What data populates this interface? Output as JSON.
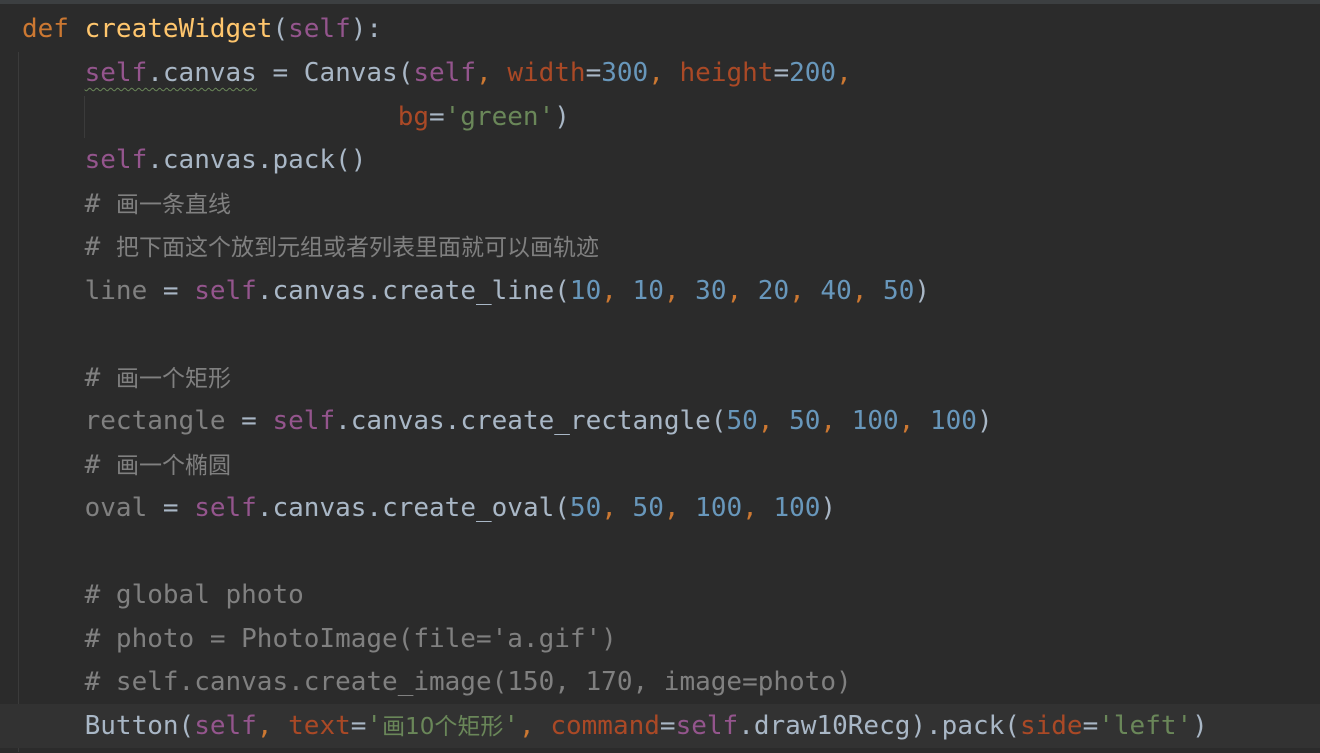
{
  "colors": {
    "background": "#2b2b2b",
    "keyword": "#cc7832",
    "function_name": "#ffc66d",
    "self": "#94558d",
    "parameter": "#aa4926",
    "number": "#6897bb",
    "string": "#6a8759",
    "comment": "#808080",
    "identifier": "#a9b7c6"
  },
  "code": {
    "l1": {
      "def": "def",
      "sp": " ",
      "func": "createWidget",
      "open": "(",
      "self": "self",
      "close": "):"
    },
    "l2": {
      "indent": "    ",
      "self": "self",
      "attr": ".canvas",
      "assign": " = Canvas(",
      "self2": "self",
      "c1": ", ",
      "p_width": "width",
      "eq1": "=",
      "n300": "300",
      "c2": ", ",
      "p_height": "height",
      "eq2": "=",
      "n200": "200",
      "c3": ","
    },
    "l3": {
      "indent": "                        ",
      "p_bg": "bg",
      "eq": "=",
      "str": "'green'",
      "close": ")"
    },
    "l4": {
      "indent": "    ",
      "self": "self",
      "rest": ".canvas.pack()"
    },
    "l5": {
      "indent": "    ",
      "hash": "# ",
      "text": "画一条直线"
    },
    "l6": {
      "indent": "    ",
      "hash": "# ",
      "text": "把下面这个放到元组或者列表里面就可以画轨迹"
    },
    "l7": {
      "indent": "    ",
      "var": "line",
      "assign": " = ",
      "self": "self",
      "call": ".canvas.create_line(",
      "a1": "10",
      "s1": ", ",
      "a2": "10",
      "s2": ", ",
      "a3": "30",
      "s3": ", ",
      "a4": "20",
      "s4": ", ",
      "a5": "40",
      "s5": ", ",
      "a6": "50",
      "close": ")"
    },
    "l9": {
      "indent": "    ",
      "hash": "# ",
      "text": "画一个矩形"
    },
    "l10": {
      "indent": "    ",
      "var": "rectangle",
      "assign": " = ",
      "self": "self",
      "call": ".canvas.create_rectangle(",
      "a1": "50",
      "s1": ", ",
      "a2": "50",
      "s2": ", ",
      "a3": "100",
      "s3": ", ",
      "a4": "100",
      "close": ")"
    },
    "l11": {
      "indent": "    ",
      "hash": "# ",
      "text": "画一个椭圆"
    },
    "l12": {
      "indent": "    ",
      "var": "oval",
      "assign": " = ",
      "self": "self",
      "call": ".canvas.create_oval(",
      "a1": "50",
      "s1": ", ",
      "a2": "50",
      "s2": ", ",
      "a3": "100",
      "s3": ", ",
      "a4": "100",
      "close": ")"
    },
    "l14": {
      "indent": "    ",
      "text": "# global photo"
    },
    "l15": {
      "indent": "    ",
      "text": "# photo = PhotoImage(file='a.gif')"
    },
    "l16": {
      "indent": "    ",
      "text": "# self.canvas.create_image(150, 170, image=photo)"
    },
    "l17": {
      "indent": "    ",
      "btn": "Button(",
      "self": "self",
      "c1": ", ",
      "p_text": "text",
      "eq1": "=",
      "q1": "'",
      "label": "画10个矩形",
      "q2": "'",
      "c2": ", ",
      "p_command": "command",
      "eq2": "=",
      "self2": "self",
      "method": ".draw10Recg).pack(",
      "p_side": "side",
      "eq3": "=",
      "str_left": "'left'",
      "close": ")"
    }
  }
}
